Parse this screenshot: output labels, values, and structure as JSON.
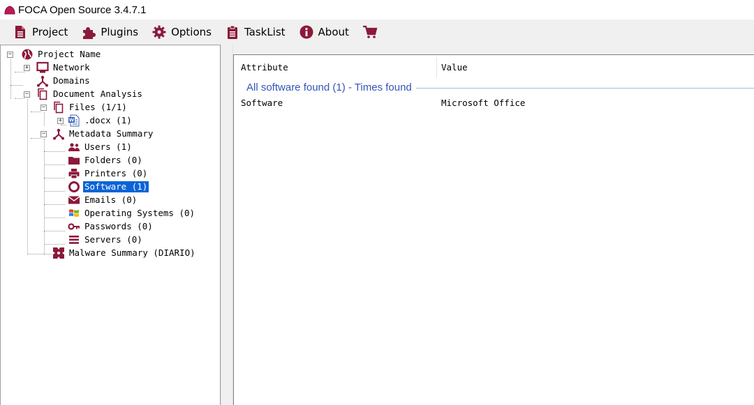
{
  "window": {
    "title": "FOCA Open Source 3.4.7.1"
  },
  "colors": {
    "brand": "#8b1a3a",
    "selection": "#0a64d6",
    "group_header": "#3355bb"
  },
  "menu": [
    {
      "label": "Project",
      "icon": "document-icon"
    },
    {
      "label": "Plugins",
      "icon": "puzzle-icon"
    },
    {
      "label": "Options",
      "icon": "gear-icon"
    },
    {
      "label": "TaskList",
      "icon": "clipboard-icon"
    },
    {
      "label": "About",
      "icon": "info-icon"
    },
    {
      "label": "",
      "icon": "cart-icon"
    }
  ],
  "tree": {
    "root": "Project Name",
    "network": "Network",
    "domains": "Domains",
    "document_analysis": "Document Analysis",
    "files": "Files (1/1)",
    "docx": ".docx (1)",
    "metadata_summary": "Metadata Summary",
    "users": "Users (1)",
    "folders": "Folders (0)",
    "printers": "Printers (0)",
    "software": "Software (1)",
    "emails": "Emails (0)",
    "operating_systems": "Operating Systems (0)",
    "passwords": "Passwords (0)",
    "servers": "Servers (0)",
    "malware_summary": "Malware Summary (DIARIO)",
    "selected": "software"
  },
  "details": {
    "columns": [
      "Attribute",
      "Value"
    ],
    "group_title": "All software found (1) - Times found",
    "rows": [
      {
        "attribute": "Software",
        "value": "Microsoft Office"
      }
    ]
  }
}
